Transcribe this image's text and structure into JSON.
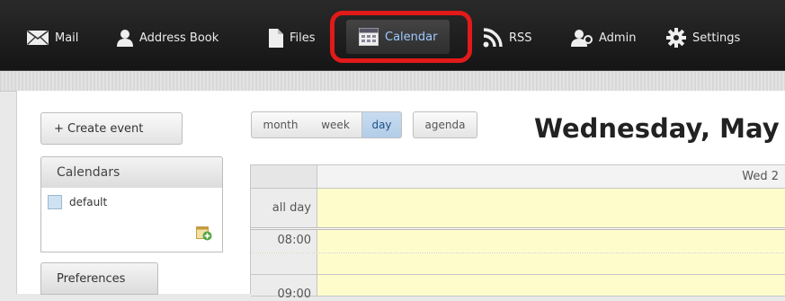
{
  "nav": {
    "items": [
      {
        "label": "Mail",
        "icon": "mail-icon"
      },
      {
        "label": "Address Book",
        "icon": "person-icon"
      },
      {
        "label": "Files",
        "icon": "file-icon"
      },
      {
        "label": "Calendar",
        "icon": "calendar-icon",
        "active": true
      },
      {
        "label": "RSS",
        "icon": "rss-icon"
      },
      {
        "label": "Admin",
        "icon": "admin-icon"
      },
      {
        "label": "Settings",
        "icon": "gear-icon"
      }
    ],
    "highlight_color": "#e21a1a"
  },
  "sidebar": {
    "create_event": "+ Create event",
    "calendars_title": "Calendars",
    "calendars": [
      {
        "name": "default"
      }
    ],
    "preferences": "Preferences"
  },
  "views": {
    "month": "month",
    "week": "week",
    "day": "day",
    "agenda": "agenda",
    "active": "day"
  },
  "header": {
    "title": "Wednesday, May"
  },
  "grid": {
    "column_header": "Wed 2",
    "all_day_label": "all day",
    "times": [
      "08:00",
      "09:00"
    ]
  },
  "colors": {
    "allday_bg": "#fffccc",
    "active_view": "#b2cde8",
    "active_nav_text": "#9ec9ff"
  }
}
